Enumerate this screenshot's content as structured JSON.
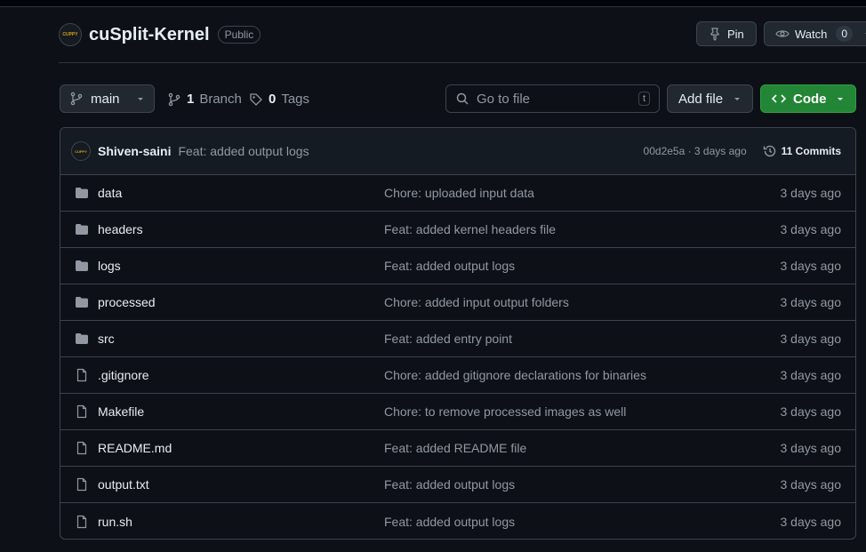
{
  "repo": {
    "avatar_text": "CUPPY",
    "name": "cuSplit-Kernel",
    "visibility": "Public"
  },
  "actions": {
    "pin_label": "Pin",
    "watch_label": "Watch",
    "watch_count": "0"
  },
  "toolbar": {
    "branch_name": "main",
    "branch_count": "1",
    "branch_label": "Branch",
    "tag_count": "0",
    "tag_label": "Tags",
    "search_placeholder": "Go to file",
    "search_shortcut": "t",
    "add_file_label": "Add file",
    "code_label": "Code"
  },
  "latest_commit": {
    "author": "Shiven-saini",
    "message": "Feat: added output logs",
    "hash_time": "00d2e5a · 3 days ago",
    "commits_label": "11 Commits"
  },
  "files": [
    {
      "name": "data",
      "type": "folder",
      "message": "Chore: uploaded input data",
      "date": "3 days ago"
    },
    {
      "name": "headers",
      "type": "folder",
      "message": "Feat: added kernel headers file",
      "date": "3 days ago"
    },
    {
      "name": "logs",
      "type": "folder",
      "message": "Feat: added output logs",
      "date": "3 days ago"
    },
    {
      "name": "processed",
      "type": "folder",
      "message": "Chore: added input output folders",
      "date": "3 days ago"
    },
    {
      "name": "src",
      "type": "folder",
      "message": "Feat: added entry point",
      "date": "3 days ago"
    },
    {
      "name": ".gitignore",
      "type": "file",
      "message": "Chore: added gitignore declarations for binaries",
      "date": "3 days ago"
    },
    {
      "name": "Makefile",
      "type": "file",
      "message": "Chore: to remove processed images as well",
      "date": "3 days ago"
    },
    {
      "name": "README.md",
      "type": "file",
      "message": "Feat: added README file",
      "date": "3 days ago"
    },
    {
      "name": "output.txt",
      "type": "file",
      "message": "Feat: added output logs",
      "date": "3 days ago"
    },
    {
      "name": "run.sh",
      "type": "file",
      "message": "Feat: added output logs",
      "date": "3 days ago"
    }
  ],
  "colors": {
    "background": "#0d1117",
    "border": "#3d444d",
    "accent_green": "#238636",
    "muted_text": "#9198a1"
  }
}
